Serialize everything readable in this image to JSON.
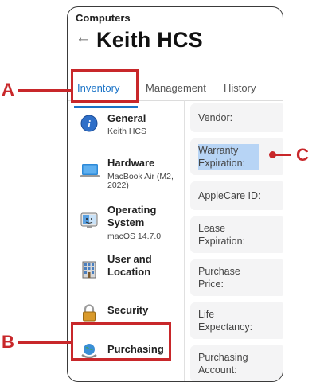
{
  "header": {
    "breadcrumb": "Computers",
    "title": "Keith HCS"
  },
  "tabs": [
    {
      "label": "Inventory",
      "active": true
    },
    {
      "label": "Management",
      "active": false
    },
    {
      "label": "History",
      "active": false
    }
  ],
  "sidebar": {
    "items": [
      {
        "name": "General",
        "sub": "Keith HCS",
        "icon": "info-icon"
      },
      {
        "name": "Hardware",
        "sub": "MacBook Air (M2, 2022)",
        "icon": "laptop-icon"
      },
      {
        "name": "Operating System",
        "sub": "macOS 14.7.0",
        "icon": "finder-icon"
      },
      {
        "name": "User and Location",
        "sub": "",
        "icon": "building-icon"
      },
      {
        "name": "Security",
        "sub": "",
        "icon": "padlock-icon"
      },
      {
        "name": "Purchasing",
        "sub": "",
        "icon": "purchasing-icon"
      }
    ]
  },
  "fields": [
    {
      "label": "Vendor:"
    },
    {
      "label": "Warranty Expiration:",
      "highlighted": true
    },
    {
      "label": "AppleCare ID:"
    },
    {
      "label": "Lease Expiration:"
    },
    {
      "label": "Purchase Price:"
    },
    {
      "label": "Life Expectancy:"
    },
    {
      "label": "Purchasing Account:"
    }
  ],
  "callouts": [
    {
      "letter": "A",
      "target": "Inventory tab"
    },
    {
      "letter": "B",
      "target": "Purchasing sidebar item"
    },
    {
      "letter": "C",
      "target": "Warranty Expiration field"
    }
  ],
  "colors": {
    "accent": "#1a73c7",
    "callout": "#c8272a",
    "highlight": "#b7d4f5"
  }
}
